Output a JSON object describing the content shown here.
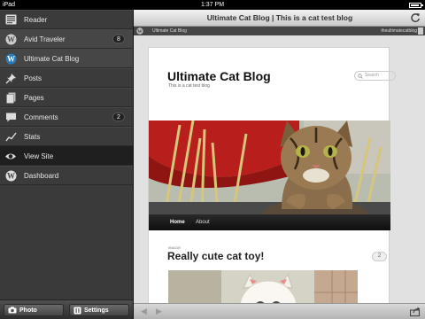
{
  "status_bar": {
    "device": "iPad",
    "time": "1:37 PM",
    "battery_level": 0.9
  },
  "sidebar": {
    "items": [
      {
        "label": "Reader",
        "icon": "reader-icon"
      },
      {
        "label": "Avid Traveler",
        "icon": "wordpress-icon",
        "count": "8"
      },
      {
        "label": "Ultimate Cat Blog",
        "icon": "wordpress-icon"
      },
      {
        "label": "Posts",
        "icon": "pin-icon"
      },
      {
        "label": "Pages",
        "icon": "pages-icon"
      },
      {
        "label": "Comments",
        "icon": "comment-icon",
        "count": "2"
      },
      {
        "label": "Stats",
        "icon": "stats-icon"
      },
      {
        "label": "View Site",
        "icon": "eye-icon"
      },
      {
        "label": "Dashboard",
        "icon": "wordpress-icon"
      }
    ],
    "active_item": "View Site",
    "toolbar": {
      "photo_label": "Photo",
      "settings_label": "Settings"
    }
  },
  "webview": {
    "page_title": "Ultimate Cat Blog | This is a cat test blog",
    "admin_bar": {
      "site_name": "Ultimate Cat Blog",
      "user": "theultimatecatblog"
    },
    "blog": {
      "title": "Ultimate Cat Blog",
      "tagline": "This is a cat test blog",
      "search_placeholder": "Search",
      "nav": [
        "Home",
        "About"
      ],
      "post": {
        "format": "IMAGE",
        "title": "Really cute cat toy!",
        "comments": "2"
      }
    }
  },
  "colors": {
    "sidebar_bg": "#3a3a3a",
    "active_bg": "#1f1f1f",
    "navbar": "#111111"
  }
}
